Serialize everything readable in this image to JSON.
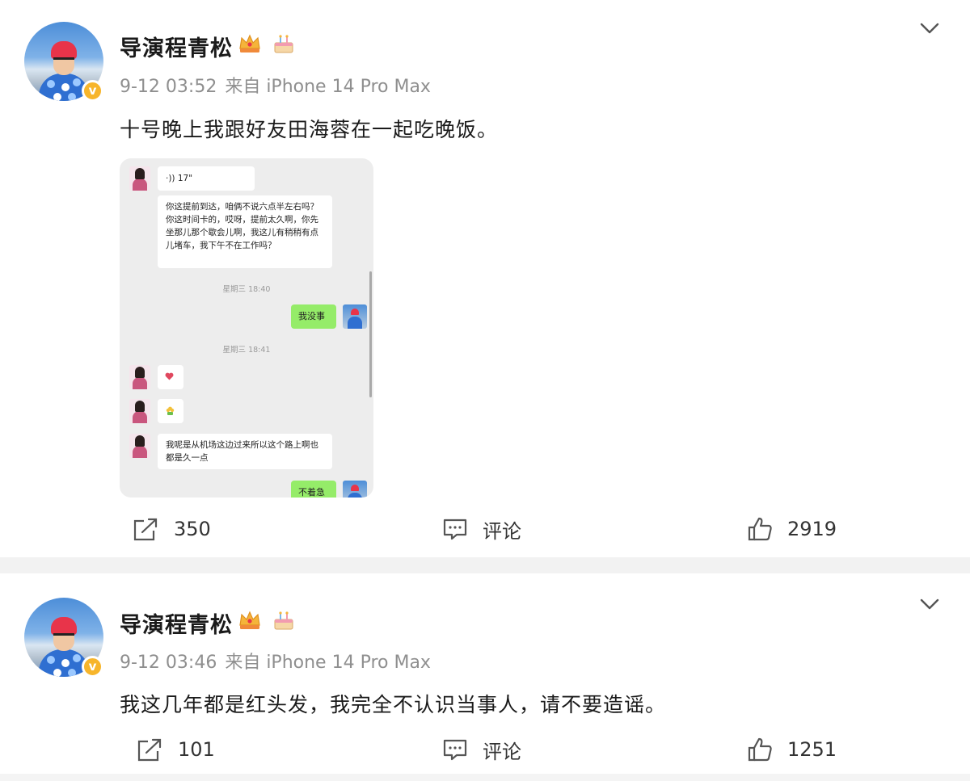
{
  "posts": [
    {
      "username": "导演程青松",
      "time": "9-12 03:52",
      "source": "来自 iPhone 14 Pro Max",
      "text": "十号晚上我跟好友田海蓉在一起吃晚饭。",
      "reposts": "350",
      "comment_label": "评论",
      "likes": "2919",
      "chat": {
        "voice": "·)) 17\"",
        "message1": "你这提前到达，咱俩不说六点半左右吗？你这时间卡的，哎呀，提前太久啊，你先坐那儿那个歇会儿啊，我这儿有稍稍有点儿堵车，我下午不在工作吗？",
        "time1": "星期三 18:40",
        "reply1": "我没事",
        "time2": "星期三 18:41",
        "message2": "我呢是从机场这边过来所以这个路上啊也都是久一点",
        "reply2": "不着急"
      }
    },
    {
      "username": "导演程青松",
      "time": "9-12 03:46",
      "source": "来自 iPhone 14 Pro Max",
      "text": "我这几年都是红头发，我完全不认识当事人，请不要造谣。",
      "reposts": "101",
      "comment_label": "评论",
      "likes": "1251"
    }
  ],
  "colors": {
    "username": "#1a1a1a",
    "meta": "#8f8f8f",
    "verified_badge": "#f7b52b",
    "wechat_green": "#95ec69",
    "separator": "#f2f2f2"
  },
  "icons": [
    "avatar",
    "verified-badge",
    "crown-icon",
    "cake-icon",
    "chevron-down-icon",
    "repost-icon",
    "comment-icon",
    "like-icon",
    "heart-emoji",
    "flower-emoji"
  ]
}
